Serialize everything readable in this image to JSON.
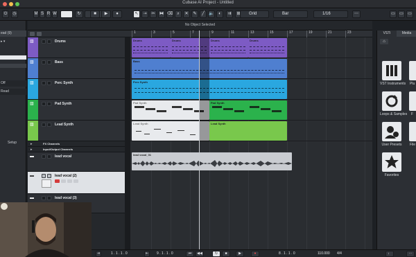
{
  "window": {
    "title": "Cubase AI Project - Untitled"
  },
  "toolbar": {
    "mode_buttons": [
      "M",
      "S",
      "R",
      "W"
    ],
    "grid_label": "Grid",
    "grid_type": "Bar",
    "quantize": "1/16"
  },
  "infoline": {
    "text": "No Object Selected"
  },
  "inspector": {
    "rows": [
      "ead (9)",
      "",
      "",
      "",
      "Read",
      "",
      "",
      "",
      "Setup"
    ],
    "setup_label": "Setup",
    "off_label": "Off"
  },
  "tracks": [
    {
      "name": "Drums",
      "color": "#7d5bc4"
    },
    {
      "name": "Bass",
      "color": "#4f7fd0"
    },
    {
      "name": "Perc Synth",
      "color": "#2aa7e0"
    },
    {
      "name": "Pad Synth",
      "color": "#2bb24c"
    },
    {
      "name": "Lead Synth",
      "color": "#79c84c"
    }
  ],
  "folders": [
    {
      "name": "FX Channels"
    },
    {
      "name": "Input/Output Channels"
    }
  ],
  "audio_tracks": [
    {
      "name": "lead vocal"
    },
    {
      "name": "lead vocal (2)"
    },
    {
      "name": "lead vocal (3)"
    }
  ],
  "ruler": {
    "bars": [
      "1",
      "3",
      "5",
      "7",
      "9",
      "11",
      "13",
      "15",
      "17",
      "19",
      "21",
      "23"
    ]
  },
  "parts": {
    "drums": "Drums",
    "bass": "Bass",
    "perc": "Perc Synth",
    "pad": "Pad Synth",
    "lead": "Lead Synth",
    "vocal": "lead vocal_01"
  },
  "rightzone": {
    "tabs": [
      "VSTi",
      "Media"
    ],
    "items": [
      {
        "label": "VST Instruments",
        "icon": "piano-icon"
      },
      {
        "label": "Loops & Samples",
        "icon": "loop-icon"
      },
      {
        "label": "User Presets",
        "icon": "user-presets-icon"
      },
      {
        "label": "Favorites",
        "icon": "star-icon"
      }
    ],
    "partial_labels": [
      "Plu",
      "F",
      "File"
    ]
  },
  "transport": {
    "left_position": "1 . 1 . 1 . 0",
    "right_position": "9 . 1 . 1 . 0",
    "time_display": "8 . 1 . 1 . 0",
    "tempo": "110.000",
    "signature": "4/4"
  }
}
